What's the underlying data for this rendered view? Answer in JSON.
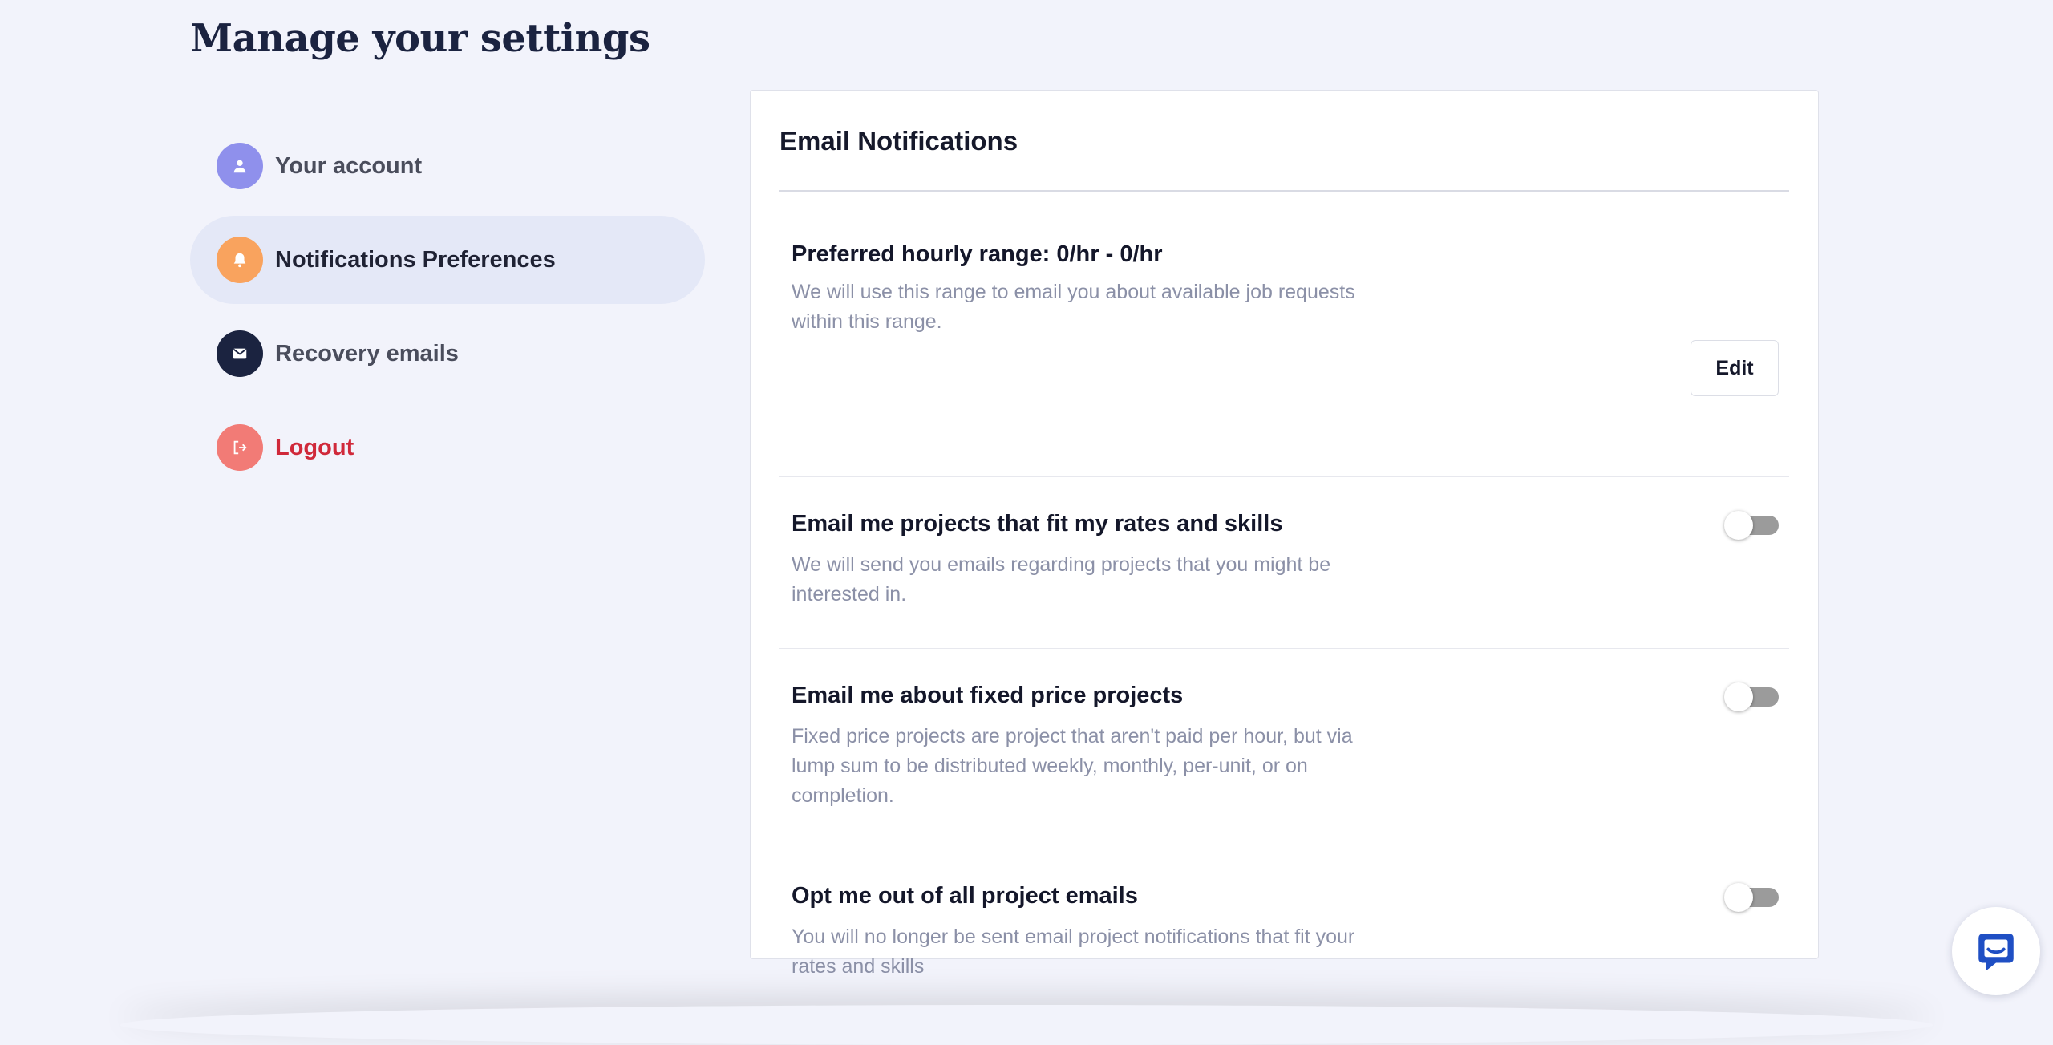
{
  "page": {
    "title": "Manage your settings"
  },
  "sidebar": {
    "items": [
      {
        "label": "Your account",
        "icon": "user-icon",
        "color": "#8f90ec"
      },
      {
        "label": "Notifications Preferences",
        "icon": "bell-icon",
        "color": "#f9a35e"
      },
      {
        "label": "Recovery emails",
        "icon": "envelope-icon",
        "color": "#1b2340"
      },
      {
        "label": "Logout",
        "icon": "logout-icon",
        "color": "#f27b76"
      }
    ]
  },
  "card": {
    "title": "Email Notifications",
    "rows": [
      {
        "title": "Preferred hourly range: 0/hr - 0/hr",
        "description": "We will use this range to email you about available job requests within this range.",
        "action_label": "Edit"
      },
      {
        "title": "Email me projects that fit my rates and skills",
        "description": "We will send you emails regarding projects that you might be interested in.",
        "enabled": false
      },
      {
        "title": "Email me about fixed price projects",
        "description": "Fixed price projects are project that aren't paid per hour, but via lump sum to be distributed weekly, monthly, per-unit, or on completion.",
        "enabled": false
      },
      {
        "title": "Opt me out of all project emails",
        "description": "You will no longer be sent email project notifications that fit your rates and skills",
        "enabled": false
      }
    ]
  },
  "chat_widget": {
    "icon": "chat-bubble-icon",
    "color": "#1f4fc4"
  }
}
